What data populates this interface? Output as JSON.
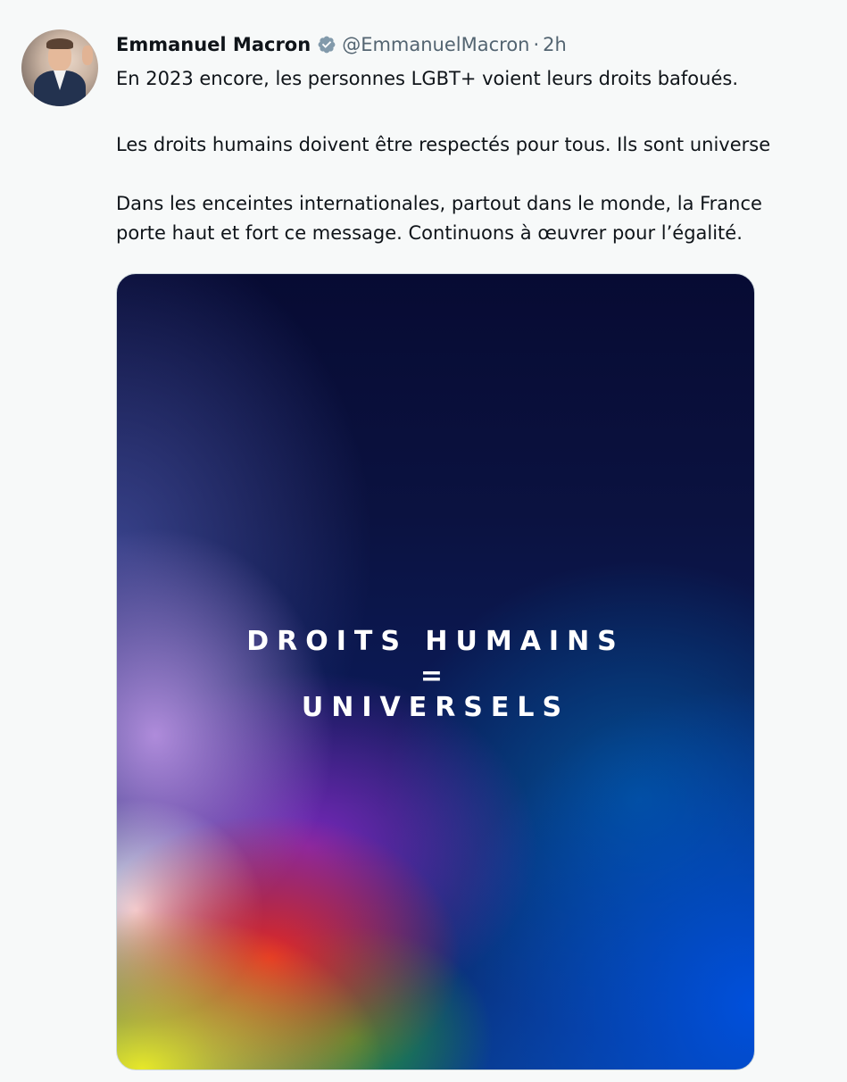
{
  "tweet": {
    "author_name": "Emmanuel Macron",
    "handle": "@EmmanuelMacron",
    "separator": "·",
    "time": "2h",
    "verified_icon": "verified-badge-icon",
    "lines": [
      "En 2023 encore, les personnes LGBT+ voient leurs droits bafoués.",
      "Les droits humains doivent être respectés pour tous. Ils sont universe",
      "Dans les enceintes internationales, partout dans le monde, la France",
      "porte haut et fort ce message. Continuons à œuvrer pour l’égalité."
    ],
    "media": {
      "line1": "DROITS HUMAINS",
      "line2": "=",
      "line3": "UNIVERSELS"
    }
  },
  "colors": {
    "name": "#0f1419",
    "secondary": "#536471",
    "verified_badge": "#829aab",
    "background": "#f7f9f9"
  }
}
